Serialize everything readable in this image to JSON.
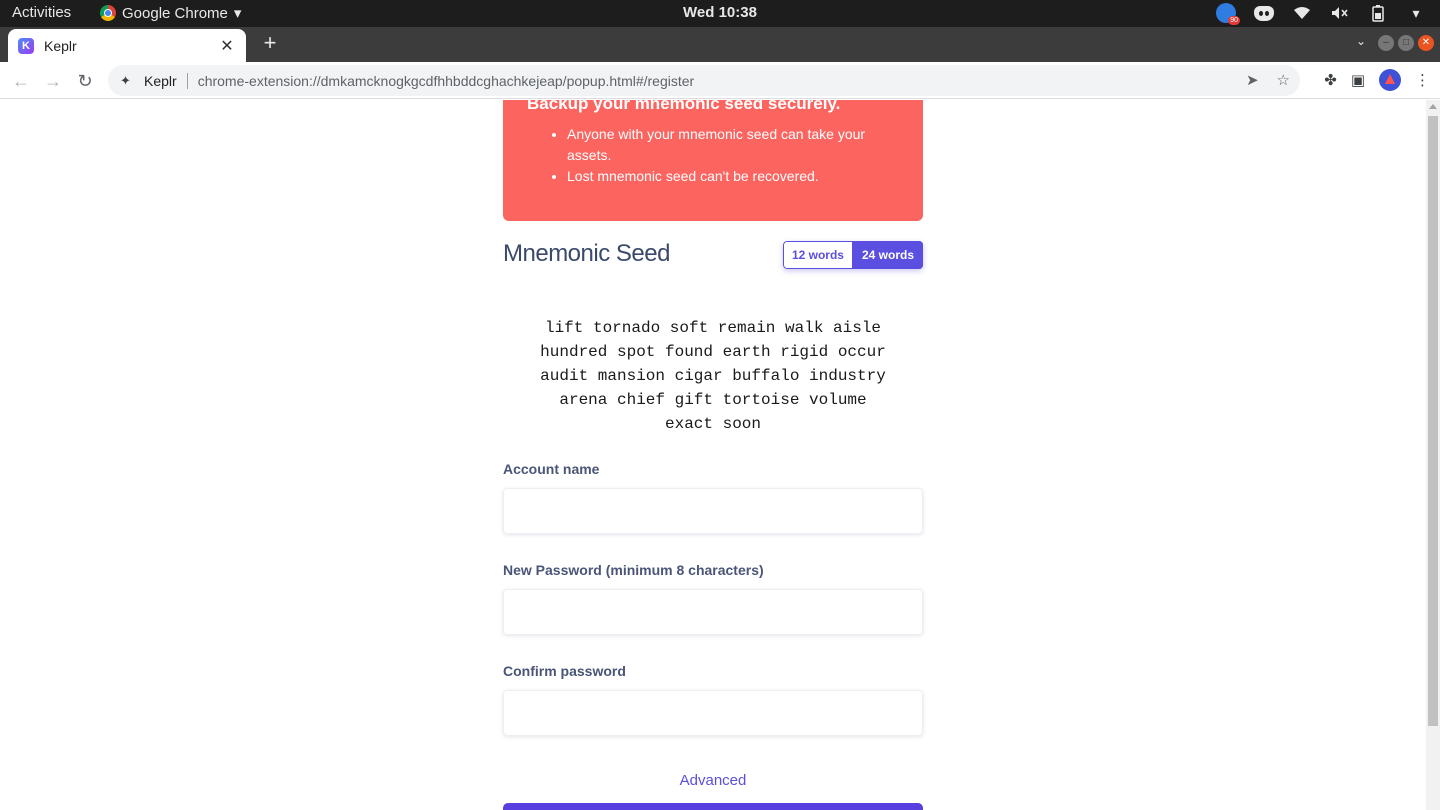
{
  "os_bar": {
    "activities": "Activities",
    "app_name": "Google Chrome",
    "clock": "Wed 10:38",
    "tray_badge": "90"
  },
  "browser": {
    "tab_title": "Keplr",
    "omnibox_site": "Keplr",
    "url": "chrome-extension://dmkamcknogkgcdfhhbddcghachkejeap/popup.html#/register"
  },
  "alert": {
    "title": "Backup your mnemonic seed securely.",
    "items": [
      "Anyone with your mnemonic seed can take your assets.",
      "Lost mnemonic seed can't be recovered."
    ]
  },
  "seed": {
    "title": "Mnemonic Seed",
    "toggle_12": "12 words",
    "toggle_24": "24 words",
    "selected": "24 words",
    "words": "lift tornado soft remain walk aisle hundred spot found earth rigid occur audit mansion cigar buffalo industry arena chief gift tortoise volume exact soon"
  },
  "form": {
    "account_name_label": "Account name",
    "account_name_value": "",
    "password_label": "New Password (minimum 8 characters)",
    "password_value": "",
    "confirm_label": "Confirm password",
    "confirm_value": "",
    "advanced": "Advanced"
  },
  "colors": {
    "accent": "#5a4fe0",
    "alert_bg": "#fc6460"
  }
}
